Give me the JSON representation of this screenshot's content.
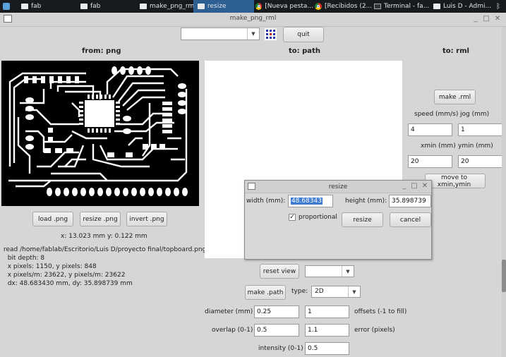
{
  "taskbar": {
    "items": [
      {
        "label": "fab"
      },
      {
        "label": "fab"
      },
      {
        "label": "make_png_rml"
      },
      {
        "label": "resize"
      },
      {
        "label": "[Nueva pesta..."
      },
      {
        "label": "[Recibidos (2..."
      },
      {
        "label": "Terminal - fa..."
      },
      {
        "label": "Luis D - Admi..."
      }
    ]
  },
  "window": {
    "title": "make_png_rml",
    "quit_label": "quit",
    "top_combo_value": ""
  },
  "columns": {
    "from": "from: png",
    "to_path": "to: path",
    "to_rml": "to: rml"
  },
  "png_panel": {
    "load_label": "load .png",
    "resize_label": "resize .png",
    "invert_label": "invert .png",
    "coords": "x: 13.023 mm  y: 0.122 mm",
    "info": [
      "read /home/fablab/Escritorio/Luis D/proyecto final/topboard.png",
      "  bit depth: 8",
      "  x pixels: 1150, y pixels: 848",
      "  x pixels/m: 23622, y pixels/m: 23622",
      "  dx: 48.683430 mm, dy: 35.898739 mm"
    ]
  },
  "rml_panel": {
    "make_rml_label": "make .rml",
    "speed_label": "speed (mm/s)",
    "jog_label": "jog (mm)",
    "speed_value": "4",
    "jog_value": "1",
    "xmin_label": "xmin (mm)",
    "ymin_label": "ymin (mm)",
    "xmin_value": "20",
    "ymin_value": "20",
    "move_label": "move to xmin,ymin"
  },
  "path_panel": {
    "reset_view_label": "reset view",
    "view_combo_value": "",
    "make_path_label": "make .path",
    "type_label": "type:",
    "type_value": "2D",
    "diameter_label": "diameter (mm)",
    "diameter_value": "0.25",
    "offsets_value": "1",
    "offsets_label": "offsets (-1 to fill)",
    "overlap_label": "overlap (0-1)",
    "overlap_value": "0.5",
    "error_value": "1.1",
    "error_label": "error (pixels)",
    "intensity_label": "intensity (0-1)",
    "intensity_value": "0.5"
  },
  "resize_dialog": {
    "title": "resize",
    "width_label": "width (mm):",
    "width_value": "48.68343",
    "height_label": "height (mm):",
    "height_value": "35.898739",
    "proportional_label": "proportional",
    "proportional_checked": true,
    "resize_label": "resize",
    "cancel_label": "cancel"
  }
}
